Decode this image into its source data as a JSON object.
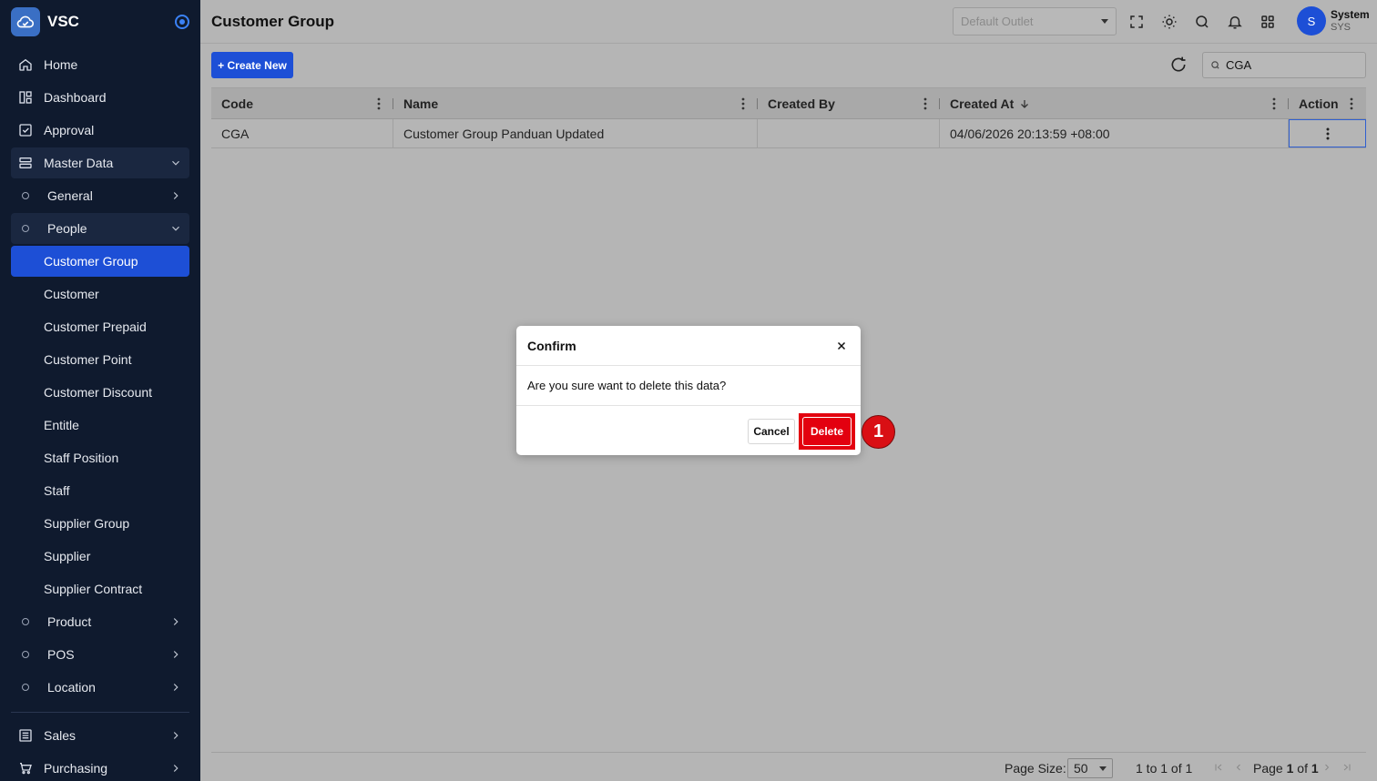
{
  "app": {
    "name": "VSC"
  },
  "sidebar": {
    "items": [
      {
        "label": "Home"
      },
      {
        "label": "Dashboard"
      },
      {
        "label": "Approval"
      },
      {
        "label": "Master Data"
      },
      {
        "label": "General"
      },
      {
        "label": "People"
      },
      {
        "label": "Customer Group"
      },
      {
        "label": "Customer"
      },
      {
        "label": "Customer Prepaid"
      },
      {
        "label": "Customer Point"
      },
      {
        "label": "Customer Discount"
      },
      {
        "label": "Entitle"
      },
      {
        "label": "Staff Position"
      },
      {
        "label": "Staff"
      },
      {
        "label": "Supplier Group"
      },
      {
        "label": "Supplier"
      },
      {
        "label": "Supplier Contract"
      },
      {
        "label": "Product"
      },
      {
        "label": "POS"
      },
      {
        "label": "Location"
      },
      {
        "label": "Sales"
      },
      {
        "label": "Purchasing"
      }
    ]
  },
  "header": {
    "title": "Customer Group",
    "outlet_placeholder": "Default Outlet",
    "user": {
      "initial": "S",
      "name": "System",
      "code": "SYS"
    }
  },
  "toolbar": {
    "create_label": "+ Create New",
    "search_value": "CGA"
  },
  "table": {
    "columns": [
      "Code",
      "Name",
      "Created By",
      "Created At",
      "Action"
    ],
    "rows": [
      {
        "code": "CGA",
        "name": "Customer Group Panduan Updated",
        "created_by": "",
        "created_at": "04/06/2026 20:13:59 +08:00"
      }
    ]
  },
  "pagination": {
    "page_size_label": "Page Size:",
    "page_size": "50",
    "range": "1 to 1 of 1",
    "page_label": "Page",
    "page_current": "1",
    "page_of": "of",
    "page_total": "1"
  },
  "modal": {
    "title": "Confirm",
    "message": "Are you sure want to delete this data?",
    "cancel_label": "Cancel",
    "delete_label": "Delete"
  },
  "annotation": {
    "step": "1"
  },
  "colors": {
    "sidebar_bg": "#0f1a2e",
    "accent": "#1d4fd6",
    "danger": "#e3000f"
  }
}
